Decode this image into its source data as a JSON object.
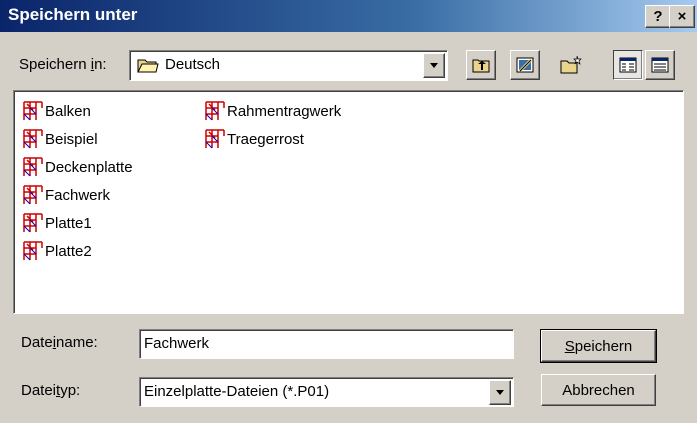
{
  "window": {
    "title": "Speichern unter",
    "help_glyph": "?",
    "close_glyph": "×"
  },
  "save_in": {
    "label_pre": "Speichern ",
    "label_accel": "i",
    "label_post": "n:",
    "value": "Deutsch"
  },
  "toolbar": {
    "icons": [
      "up-folder-icon",
      "desktop-icon",
      "new-folder-icon",
      "list-view-icon",
      "details-view-icon"
    ]
  },
  "files": [
    {
      "name": "Balken"
    },
    {
      "name": "Beispiel"
    },
    {
      "name": "Deckenplatte"
    },
    {
      "name": "Fachwerk"
    },
    {
      "name": "Platte1"
    },
    {
      "name": "Platte2"
    },
    {
      "name": "Rahmentragwerk"
    },
    {
      "name": "Traegerrost"
    }
  ],
  "filename": {
    "label_pre": "Date",
    "label_accel": "i",
    "label_post": "name:",
    "value": "Fachwerk"
  },
  "filetype": {
    "label_pre": "Datei",
    "label_accel": "t",
    "label_post": "yp:",
    "value": "Einzelplatte-Dateien (*.P01)"
  },
  "buttons": {
    "save_accel": "S",
    "save_rest": "peichern",
    "cancel": "Abbrechen"
  },
  "colors": {
    "title_bar": "#0a246a",
    "face": "#d4d0c8",
    "file_icon": "#cc0000"
  }
}
